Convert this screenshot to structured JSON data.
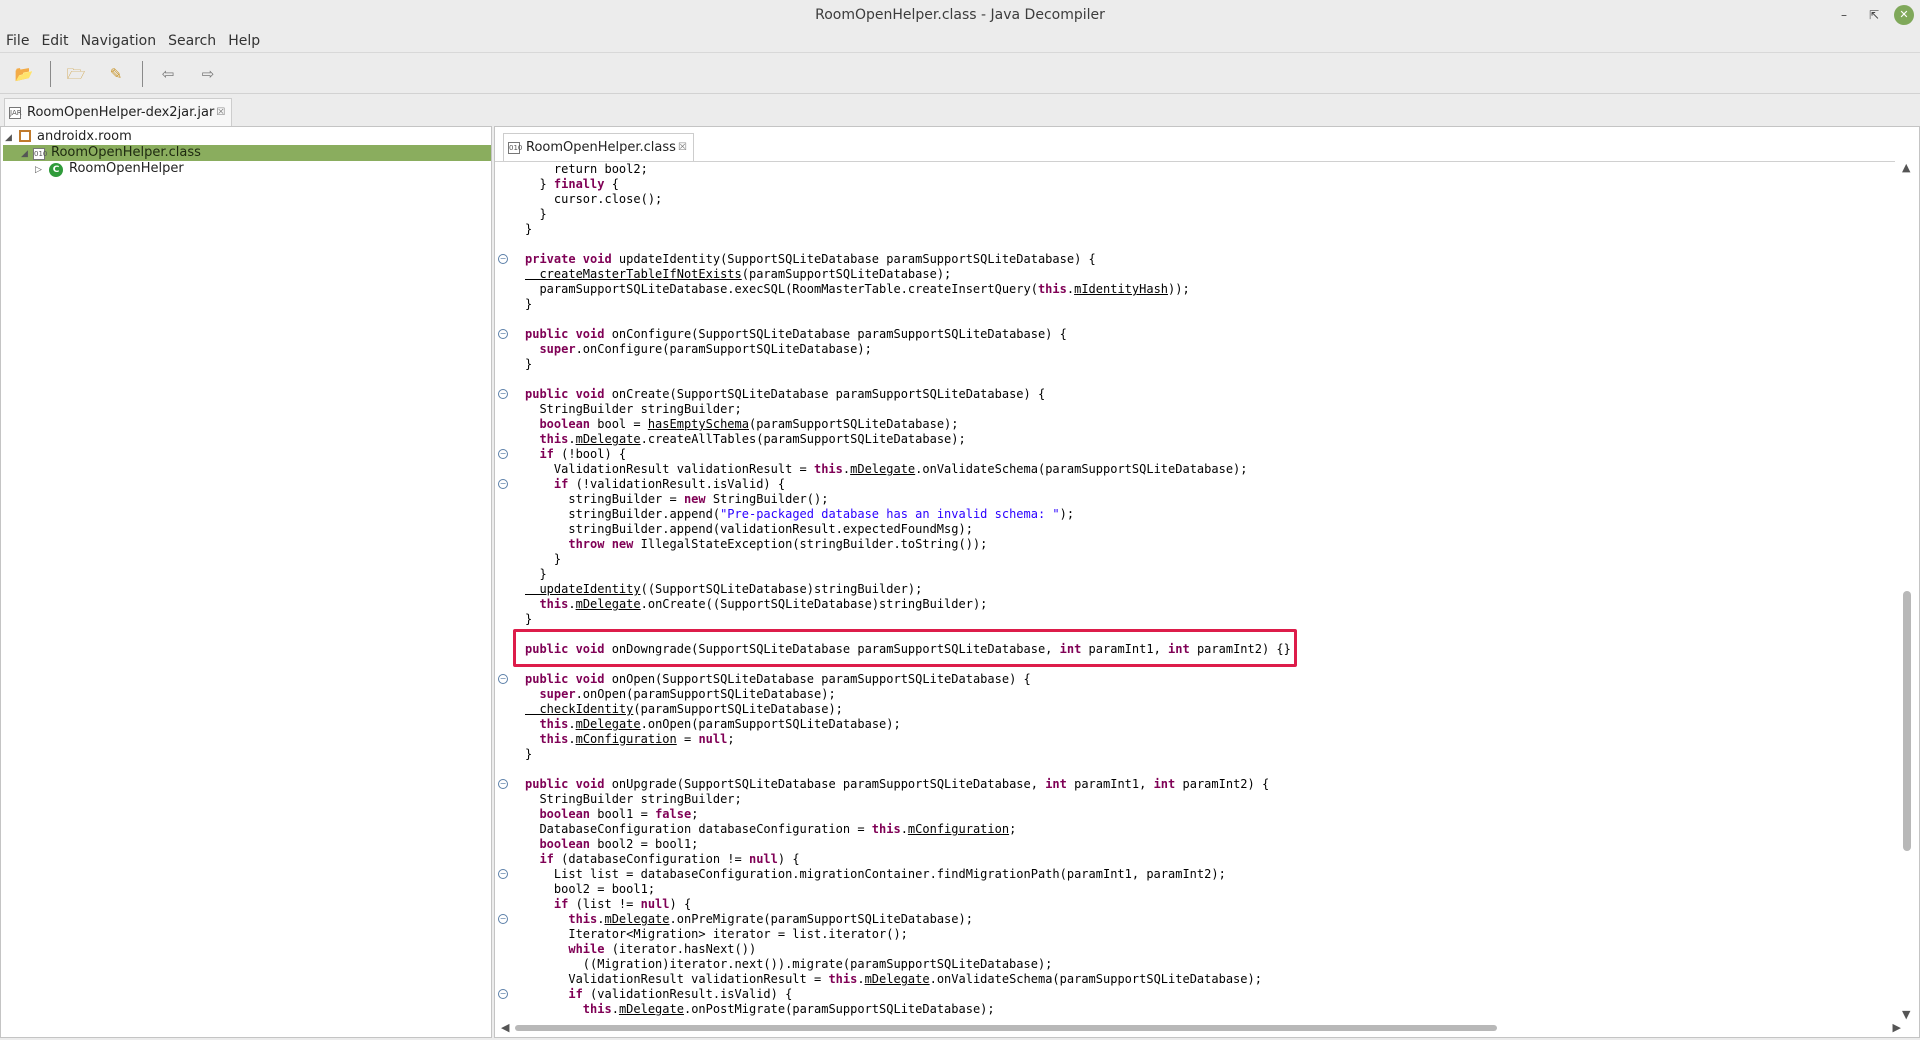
{
  "window": {
    "title": "RoomOpenHelper.class - Java Decompiler"
  },
  "menu": [
    "File",
    "Edit",
    "Navigation",
    "Search",
    "Help"
  ],
  "jar_tab": {
    "label": "RoomOpenHelper-dex2jar.jar"
  },
  "tree": {
    "package": "androidx.room",
    "file": "RoomOpenHelper.class",
    "class": "RoomOpenHelper"
  },
  "editor_tab": {
    "label": "RoomOpenHelper.class"
  },
  "icons": {
    "open_file": "folder-open-icon",
    "open_type": "open-type-icon",
    "search": "search-icon",
    "back": "arrow-left-icon",
    "forward": "arrow-right-icon",
    "close": "close-icon"
  },
  "colors": {
    "highlight_border": "#dd1c4a",
    "selection": "#8aad5e",
    "keyword": "#7f0055",
    "string": "#2a00ff"
  },
  "code": [
    [
      [
        4,
        "",
        "return"
      ],
      [
        0,
        "",
        " bool2;"
      ]
    ],
    [
      [
        2,
        "",
        "} "
      ],
      [
        0,
        "kw",
        "finally"
      ],
      [
        0,
        "",
        " {"
      ]
    ],
    [
      [
        4,
        "",
        "cursor.close();"
      ]
    ],
    [
      [
        2,
        "",
        "}"
      ]
    ],
    [
      [
        0,
        "",
        "}"
      ]
    ],
    [],
    [
      [
        0,
        "kw",
        "private void"
      ],
      [
        0,
        "",
        " updateIdentity(SupportSQLiteDatabase paramSupportSQLiteDatabase) {"
      ]
    ],
    [
      [
        2,
        "u",
        "createMasterTableIfNotExists"
      ],
      [
        0,
        "",
        "(paramSupportSQLiteDatabase);"
      ]
    ],
    [
      [
        2,
        "",
        "paramSupportSQLiteDatabase.execSQL(RoomMasterTable.createInsertQuery("
      ],
      [
        0,
        "kw",
        "this"
      ],
      [
        0,
        "",
        "."
      ],
      [
        0,
        "u",
        "mIdentityHash"
      ],
      [
        0,
        "",
        "));"
      ]
    ],
    [
      [
        0,
        "",
        "}"
      ]
    ],
    [],
    [
      [
        0,
        "kw",
        "public void"
      ],
      [
        0,
        "",
        " onConfigure(SupportSQLiteDatabase paramSupportSQLiteDatabase) {"
      ]
    ],
    [
      [
        2,
        "kw",
        "super"
      ],
      [
        0,
        "",
        ".onConfigure(paramSupportSQLiteDatabase);"
      ]
    ],
    [
      [
        0,
        "",
        "}"
      ]
    ],
    [],
    [
      [
        0,
        "kw",
        "public void"
      ],
      [
        0,
        "",
        " onCreate(SupportSQLiteDatabase paramSupportSQLiteDatabase) {"
      ]
    ],
    [
      [
        2,
        "",
        "StringBuilder stringBuilder;"
      ]
    ],
    [
      [
        2,
        "kw",
        "boolean"
      ],
      [
        0,
        "",
        " bool = "
      ],
      [
        0,
        "u",
        "hasEmptySchema"
      ],
      [
        0,
        "",
        "(paramSupportSQLiteDatabase);"
      ]
    ],
    [
      [
        2,
        "kw",
        "this"
      ],
      [
        0,
        "",
        "."
      ],
      [
        0,
        "u",
        "mDelegate"
      ],
      [
        0,
        "",
        ".createAllTables(paramSupportSQLiteDatabase);"
      ]
    ],
    [
      [
        2,
        "kw",
        "if"
      ],
      [
        0,
        "",
        " (!bool) {"
      ]
    ],
    [
      [
        4,
        "",
        "ValidationResult validationResult = "
      ],
      [
        0,
        "kw",
        "this"
      ],
      [
        0,
        "",
        "."
      ],
      [
        0,
        "u",
        "mDelegate"
      ],
      [
        0,
        "",
        ".onValidateSchema(paramSupportSQLiteDatabase);"
      ]
    ],
    [
      [
        4,
        "kw",
        "if"
      ],
      [
        0,
        "",
        " (!validationResult.isValid) {"
      ]
    ],
    [
      [
        6,
        "",
        "stringBuilder = "
      ],
      [
        0,
        "kw",
        "new"
      ],
      [
        0,
        "",
        " StringBuilder();"
      ]
    ],
    [
      [
        6,
        "",
        "stringBuilder.append("
      ],
      [
        0,
        "str",
        "\"Pre-packaged database has an invalid schema: \""
      ],
      [
        0,
        "",
        ");"
      ]
    ],
    [
      [
        6,
        "",
        "stringBuilder.append(validationResult.expectedFoundMsg);"
      ]
    ],
    [
      [
        6,
        "kw",
        "throw new"
      ],
      [
        0,
        "",
        " IllegalStateException(stringBuilder.toString());"
      ]
    ],
    [
      [
        4,
        "",
        "}"
      ]
    ],
    [
      [
        2,
        "",
        "}"
      ]
    ],
    [
      [
        2,
        "u",
        "updateIdentity"
      ],
      [
        0,
        "",
        "((SupportSQLiteDatabase)stringBuilder);"
      ]
    ],
    [
      [
        2,
        "kw",
        "this"
      ],
      [
        0,
        "",
        "."
      ],
      [
        0,
        "u",
        "mDelegate"
      ],
      [
        0,
        "",
        ".onCreate((SupportSQLiteDatabase)stringBuilder);"
      ]
    ],
    [
      [
        0,
        "",
        "}"
      ]
    ],
    [],
    [
      [
        0,
        "kw",
        "public void"
      ],
      [
        0,
        "",
        " onDowngrade(SupportSQLiteDatabase paramSupportSQLiteDatabase, "
      ],
      [
        0,
        "kw",
        "int"
      ],
      [
        0,
        "",
        " paramInt1, "
      ],
      [
        0,
        "kw",
        "int"
      ],
      [
        0,
        "",
        " paramInt2) {}"
      ]
    ],
    [],
    [
      [
        0,
        "kw",
        "public void"
      ],
      [
        0,
        "",
        " onOpen(SupportSQLiteDatabase paramSupportSQLiteDatabase) {"
      ]
    ],
    [
      [
        2,
        "kw",
        "super"
      ],
      [
        0,
        "",
        ".onOpen(paramSupportSQLiteDatabase);"
      ]
    ],
    [
      [
        2,
        "u",
        "checkIdentity"
      ],
      [
        0,
        "",
        "(paramSupportSQLiteDatabase);"
      ]
    ],
    [
      [
        2,
        "kw",
        "this"
      ],
      [
        0,
        "",
        "."
      ],
      [
        0,
        "u",
        "mDelegate"
      ],
      [
        0,
        "",
        ".onOpen(paramSupportSQLiteDatabase);"
      ]
    ],
    [
      [
        2,
        "kw",
        "this"
      ],
      [
        0,
        "",
        "."
      ],
      [
        0,
        "u",
        "mConfiguration"
      ],
      [
        0,
        "",
        " = "
      ],
      [
        0,
        "kw",
        "null"
      ],
      [
        0,
        "",
        ";"
      ]
    ],
    [
      [
        0,
        "",
        "}"
      ]
    ],
    [],
    [
      [
        0,
        "kw",
        "public void"
      ],
      [
        0,
        "",
        " onUpgrade(SupportSQLiteDatabase paramSupportSQLiteDatabase, "
      ],
      [
        0,
        "kw",
        "int"
      ],
      [
        0,
        "",
        " paramInt1, "
      ],
      [
        0,
        "kw",
        "int"
      ],
      [
        0,
        "",
        " paramInt2) {"
      ]
    ],
    [
      [
        2,
        "",
        "StringBuilder stringBuilder;"
      ]
    ],
    [
      [
        2,
        "kw",
        "boolean"
      ],
      [
        0,
        "",
        " bool1 = "
      ],
      [
        0,
        "kw",
        "false"
      ],
      [
        0,
        "",
        ";"
      ]
    ],
    [
      [
        2,
        "",
        "DatabaseConfiguration databaseConfiguration = "
      ],
      [
        0,
        "kw",
        "this"
      ],
      [
        0,
        "",
        "."
      ],
      [
        0,
        "u",
        "mConfiguration"
      ],
      [
        0,
        "",
        ";"
      ]
    ],
    [
      [
        2,
        "kw",
        "boolean"
      ],
      [
        0,
        "",
        " bool2 = bool1;"
      ]
    ],
    [
      [
        2,
        "kw",
        "if"
      ],
      [
        0,
        "",
        " (databaseConfiguration != "
      ],
      [
        0,
        "kw",
        "null"
      ],
      [
        0,
        "",
        ") {"
      ]
    ],
    [
      [
        4,
        "",
        "List list = databaseConfiguration.migrationContainer.findMigrationPath(paramInt1, paramInt2);"
      ]
    ],
    [
      [
        4,
        "",
        "bool2 = bool1;"
      ]
    ],
    [
      [
        4,
        "kw",
        "if"
      ],
      [
        0,
        "",
        " (list != "
      ],
      [
        0,
        "kw",
        "null"
      ],
      [
        0,
        "",
        ") {"
      ]
    ],
    [
      [
        6,
        "kw",
        "this"
      ],
      [
        0,
        "",
        "."
      ],
      [
        0,
        "u",
        "mDelegate"
      ],
      [
        0,
        "",
        ".onPreMigrate(paramSupportSQLiteDatabase);"
      ]
    ],
    [
      [
        6,
        "",
        "Iterator<Migration> iterator = list.iterator();"
      ]
    ],
    [
      [
        6,
        "kw",
        "while"
      ],
      [
        0,
        "",
        " (iterator.hasNext())"
      ]
    ],
    [
      [
        8,
        "",
        "((Migration)iterator.next()).migrate(paramSupportSQLiteDatabase);"
      ]
    ],
    [
      [
        6,
        "",
        "ValidationResult validationResult = "
      ],
      [
        0,
        "kw",
        "this"
      ],
      [
        0,
        "",
        "."
      ],
      [
        0,
        "u",
        "mDelegate"
      ],
      [
        0,
        "",
        ".onValidateSchema(paramSupportSQLiteDatabase);"
      ]
    ],
    [
      [
        6,
        "kw",
        "if"
      ],
      [
        0,
        "",
        " (validationResult.isValid) {"
      ]
    ],
    [
      [
        8,
        "kw",
        "this"
      ],
      [
        0,
        "",
        "."
      ],
      [
        0,
        "u",
        "mDelegate"
      ],
      [
        0,
        "",
        ".onPostMigrate(paramSupportSQLiteDatabase);"
      ]
    ]
  ],
  "fold_lines": [
    6,
    11,
    15,
    19,
    21,
    34,
    41,
    47,
    50,
    55
  ]
}
